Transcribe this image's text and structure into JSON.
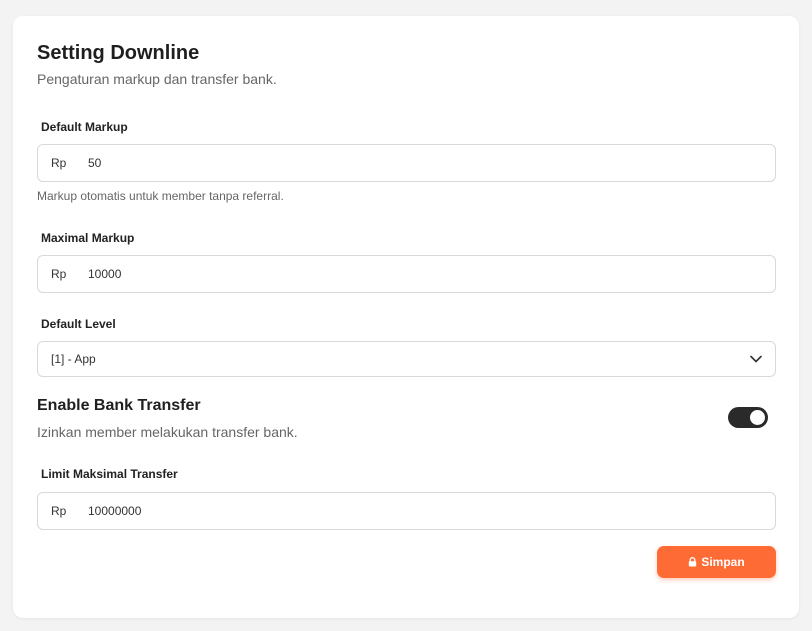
{
  "header": {
    "title": "Setting Downline",
    "subtitle": "Pengaturan markup dan transfer bank."
  },
  "default_markup": {
    "label": "Default Markup",
    "prefix": "Rp",
    "value": "50",
    "hint": "Markup otomatis untuk member tanpa referral."
  },
  "maximal_markup": {
    "label": "Maximal Markup",
    "prefix": "Rp",
    "value": "10000"
  },
  "default_level": {
    "label": "Default Level",
    "selected": "[1] - App",
    "icon": "chevron-down-icon"
  },
  "bank_transfer": {
    "title": "Enable Bank Transfer",
    "description": "Izinkan member melakukan transfer bank.",
    "enabled": true
  },
  "limit_transfer": {
    "label": "Limit Maksimal Transfer",
    "prefix": "Rp",
    "value": "10000000"
  },
  "actions": {
    "save_label": "Simpan",
    "save_icon": "lock-icon"
  },
  "colors": {
    "accent": "#ff6b35",
    "toggle_on": "#2a2a2a"
  }
}
